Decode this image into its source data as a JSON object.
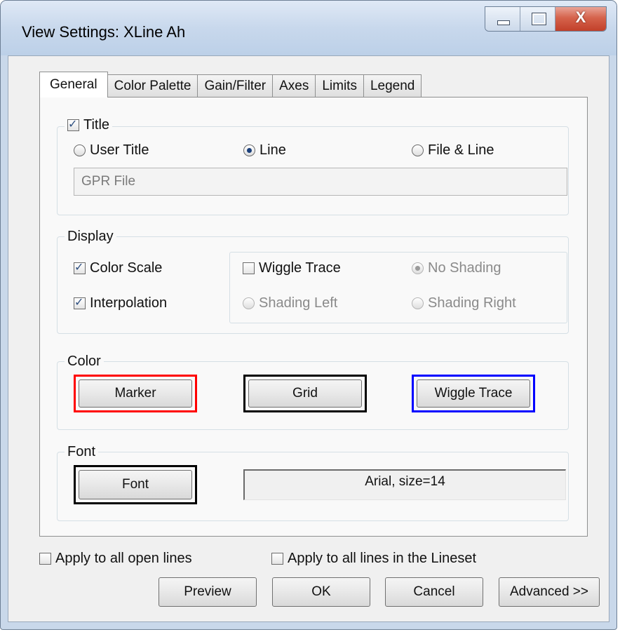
{
  "window": {
    "title": "View Settings: XLine Ah",
    "close_glyph": "X"
  },
  "tabs": [
    "General",
    "Color Palette",
    "Gain/Filter",
    "Axes",
    "Limits",
    "Legend"
  ],
  "title_group": {
    "checkbox_label": "Title",
    "checked": true,
    "options": [
      "User Title",
      "Line",
      "File & Line"
    ],
    "selected": "Line",
    "user_title_value": "GPR File"
  },
  "display_group": {
    "legend": "Display",
    "color_scale": "Color Scale",
    "interpolation": "Interpolation",
    "wiggle_trace": "Wiggle Trace",
    "no_shading": "No Shading",
    "shading_left": "Shading Left",
    "shading_right": "Shading Right"
  },
  "color_group": {
    "legend": "Color",
    "marker": {
      "label": "Marker",
      "color": "#ff0000"
    },
    "grid": {
      "label": "Grid",
      "color": "#000000"
    },
    "wiggle": {
      "label": "Wiggle Trace",
      "color": "#0000ff"
    }
  },
  "font_group": {
    "legend": "Font",
    "button": "Font",
    "display": "Arial, size=14"
  },
  "footer": {
    "apply_open": "Apply to all open lines",
    "apply_lineset": "Apply to all lines in the Lineset",
    "preview": "Preview",
    "ok": "OK",
    "cancel": "Cancel",
    "advanced": "Advanced >>"
  }
}
